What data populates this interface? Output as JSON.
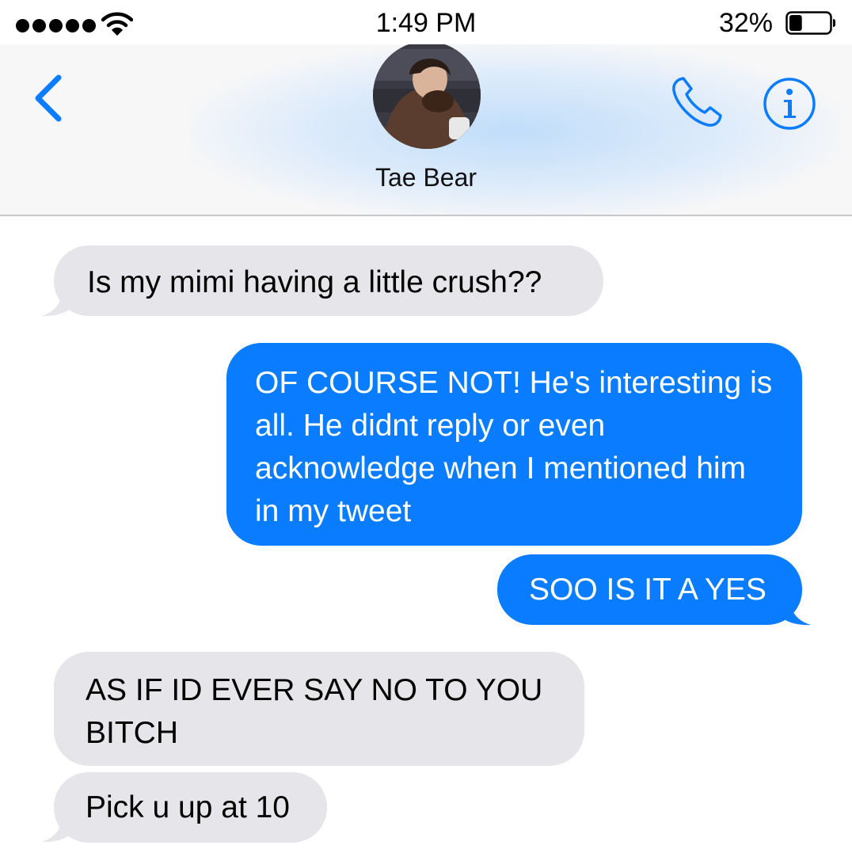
{
  "status_bar": {
    "time": "1:49 PM",
    "battery_percent": "32%",
    "battery_level": 0.32,
    "signal_dots": 5
  },
  "header": {
    "contact_name": "Tae Bear",
    "back_icon": "chevron-left-icon",
    "call_icon": "phone-icon",
    "info_icon": "info-icon",
    "accent_color": "#0a7cff"
  },
  "messages": [
    {
      "direction": "received",
      "text": "Is my mimi having a little crush??"
    },
    {
      "direction": "sent",
      "text": "OF COURSE NOT! He's interesting is all. He didnt reply or even acknowledge when I mentioned him in my tweet"
    },
    {
      "direction": "sent",
      "text": "SOO IS IT A YES"
    },
    {
      "direction": "received",
      "text": "AS IF ID EVER SAY NO TO YOU BITCH"
    },
    {
      "direction": "received",
      "text": "Pick u up at 10"
    }
  ],
  "colors": {
    "sent_bubble": "#0a7cff",
    "received_bubble": "#e5e5ea"
  }
}
